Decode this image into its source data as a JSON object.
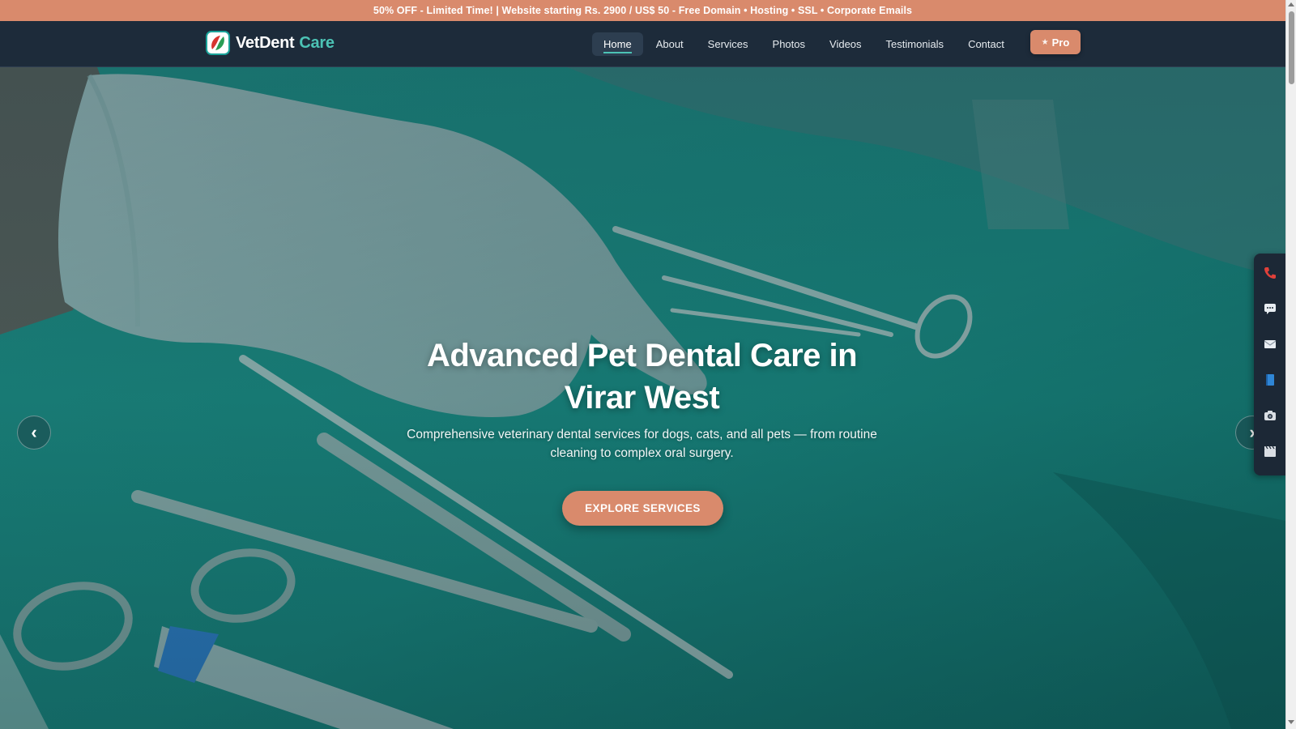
{
  "promo": {
    "text": "50% OFF - Limited Time! | Website starting Rs. 2900 / US$ 50 - Free Domain • Hosting • SSL • Corporate Emails"
  },
  "header": {
    "brand_primary": "VetDent",
    "brand_accent": "Care",
    "nav": [
      {
        "label": "Home",
        "active": true
      },
      {
        "label": "About"
      },
      {
        "label": "Services"
      },
      {
        "label": "Photos"
      },
      {
        "label": "Videos"
      },
      {
        "label": "Testimonials"
      },
      {
        "label": "Contact"
      }
    ],
    "pro_star": "★",
    "pro_label": "Pro"
  },
  "hero": {
    "title_line1": "Advanced Pet Dental Care in",
    "title_line2": "Virar West",
    "subtitle_line1": "Comprehensive veterinary dental services for dogs, cats, and all pets — from routine",
    "subtitle_line2": "cleaning to complex oral surgery.",
    "cta_label": "EXPLORE SERVICES",
    "prev_glyph": "‹",
    "next_glyph": "›"
  },
  "side_dock": {
    "items": [
      "phone-icon",
      "chat-icon",
      "mail-icon",
      "book-icon",
      "camera-icon",
      "video-icon"
    ]
  },
  "colors": {
    "promo_bg": "#d98a6c",
    "nav_bg": "#1d2b3a",
    "brand_accent": "#4cc3b5",
    "cta": "#d98a6c",
    "hero_tint": "#1b8a83"
  }
}
